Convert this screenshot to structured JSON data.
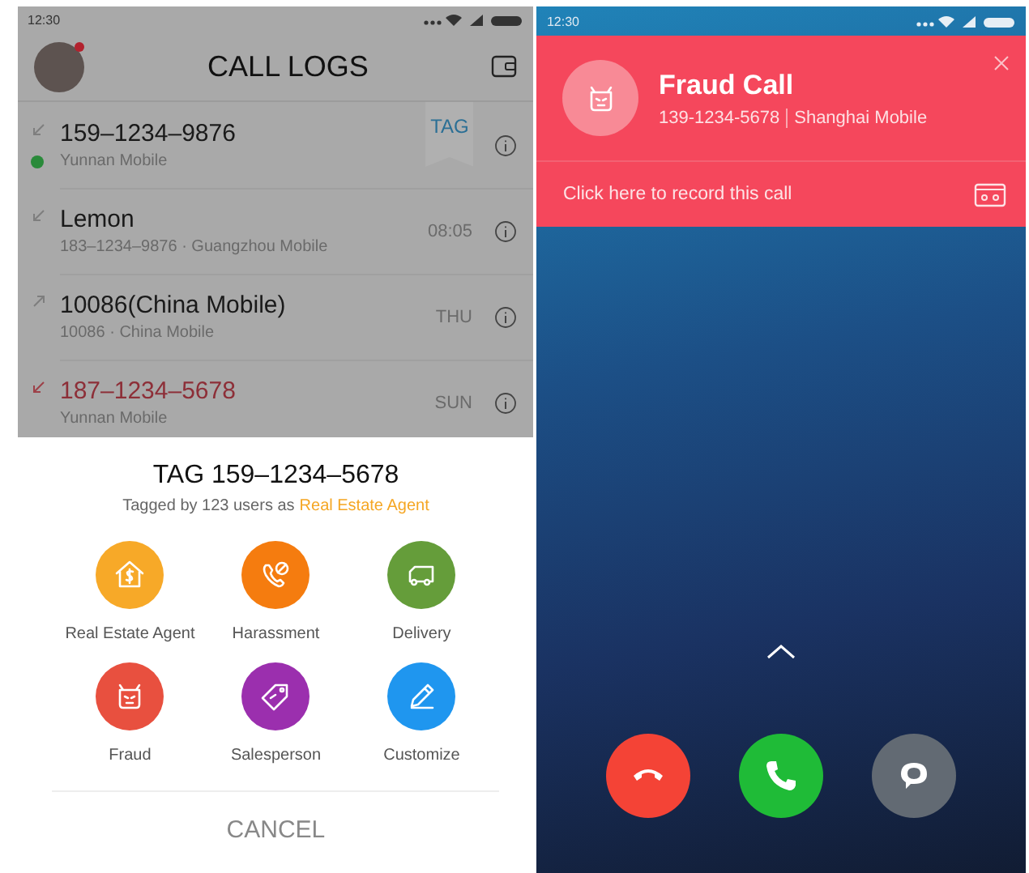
{
  "left_phone": {
    "status_bar": {
      "time": "12:30"
    },
    "header": {
      "title": "CALL LOGS"
    },
    "call_logs": [
      {
        "kind": "incoming",
        "name": "159–1234–9876",
        "detail": "Yunnan Mobile",
        "verified": true,
        "tag": "TAG"
      },
      {
        "kind": "incoming",
        "name": "Lemon",
        "detail": "183–1234–9876 · Guangzhou Mobile",
        "verified": false,
        "time": "08:05"
      },
      {
        "kind": "outgoing",
        "name": "10086(China Mobile)",
        "detail": "10086 · China Mobile",
        "verified": false,
        "time": "THU"
      },
      {
        "kind": "missed",
        "name": "187–1234–5678",
        "detail": "Yunnan Mobile",
        "verified": false,
        "time": "SUN"
      }
    ],
    "tag_sheet": {
      "title": "TAG 159–1234–5678",
      "subtitle": "Tagged by 123 users as",
      "highlight": "Real Estate Agent",
      "tags": [
        {
          "kind": "house",
          "label": "Real Estate Agent",
          "color": "#f7a928"
        },
        {
          "kind": "phone",
          "label": "Harassment",
          "color": "#f57c0f"
        },
        {
          "kind": "truck",
          "label": "Delivery",
          "color": "#659d3a"
        },
        {
          "kind": "devil",
          "label": "Fraud",
          "color": "#e8503f"
        },
        {
          "kind": "price",
          "label": "Salesperson",
          "color": "#9b2fae"
        },
        {
          "kind": "pencil",
          "label": "Customize",
          "color": "#1f96ef"
        }
      ],
      "cancel": "CANCEL"
    }
  },
  "right_phone": {
    "status_bar": {
      "time": "12:30"
    },
    "alert": {
      "title": "Fraud Call",
      "number": "139-1234-5678",
      "carrier": "Shanghai Mobile",
      "record_prompt": "Click here to record this call"
    },
    "actions": [
      {
        "kind": "decline"
      },
      {
        "kind": "answer"
      },
      {
        "kind": "message"
      }
    ]
  }
}
